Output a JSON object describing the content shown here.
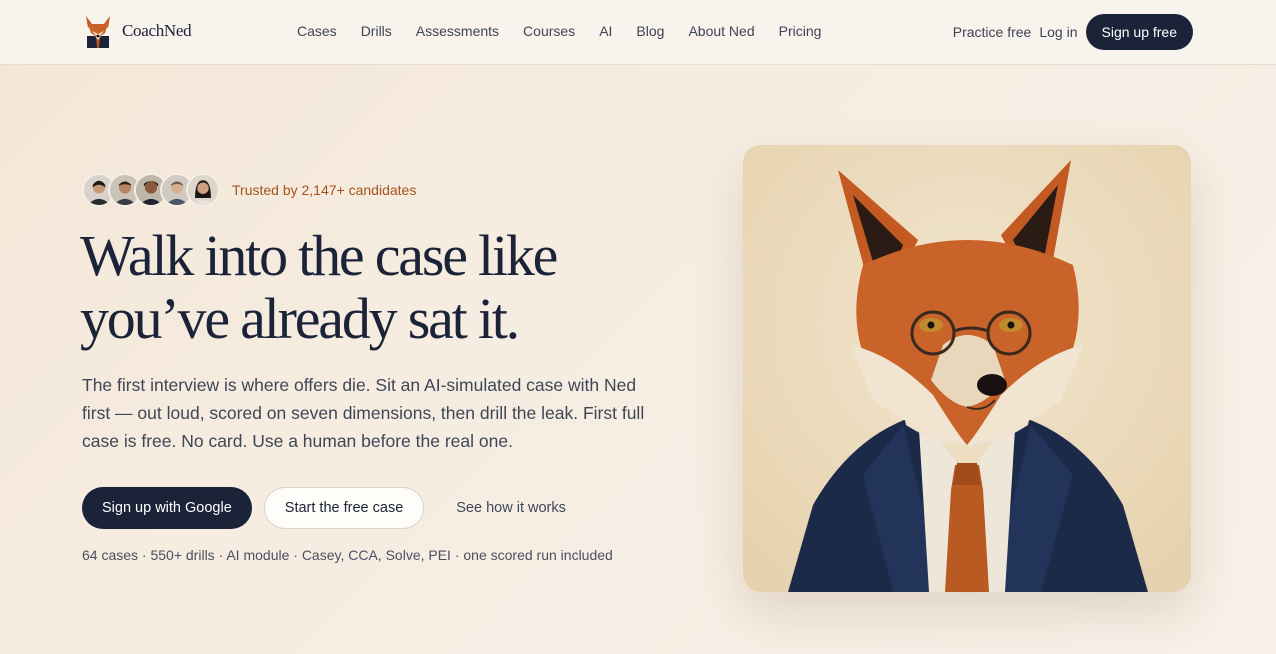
{
  "brand": {
    "name": "CoachNed",
    "logo_icon": "fox-logo-icon"
  },
  "nav": {
    "items": [
      "Cases",
      "Drills",
      "Assessments",
      "Courses",
      "AI",
      "Blog",
      "About Ned",
      "Pricing"
    ],
    "practice_free": "Practice free",
    "log_in": "Log in",
    "sign_up": "Sign up free"
  },
  "hero": {
    "trusted_text": "Trusted by 2,147+ candidates",
    "headline": "Walk into the case like you’ve already sat it.",
    "subtext": "The first interview is where offers die. Sit an AI-simulated case with Ned first — out loud, scored on seven dimensions, then drill the leak. First full case is free. No card. Use a human before the real one.",
    "cta_google": "Sign up with Google",
    "cta_free_case": "Start the free case",
    "cta_how": "See how it works",
    "meta": "64 cases · 550+ drills · AI module · Casey, CCA, Solve, PEI · one scored run included",
    "image_icon": "fox-portrait-illustration"
  },
  "colors": {
    "navy": "#1b2338",
    "accent": "#a4531d",
    "background": "#f4eadc"
  }
}
